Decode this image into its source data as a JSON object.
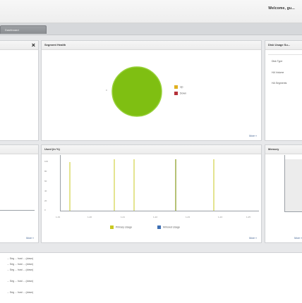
{
  "header": {
    "welcome_text": "Welcome, gu..."
  },
  "tabs": [
    {
      "label": "Dashboard"
    }
  ],
  "panels": {
    "left_top": {
      "close_glyph": "×"
    },
    "segment_health": {
      "title": "Segment Health",
      "footer": "More »",
      "legend": [
        {
          "label": "Up",
          "color": "#e0b020"
        },
        {
          "label": "Down",
          "color": "#b5323a"
        }
      ],
      "pie_color": "#7fbf12",
      "pie_label": "0"
    },
    "disk_usage": {
      "title": "Disk Usage Su...",
      "items": [
        "Disk Type",
        "HA Volume",
        "HA Segments"
      ]
    },
    "left_mid": {
      "footer": "More »"
    },
    "mid_chart": {
      "title": "Used (in %)",
      "footer": "More »",
      "y_ticks": [
        "100",
        "80",
        "60",
        "40",
        "20",
        "0"
      ],
      "x_ticks": [
        "1-19",
        "1-20",
        "1-21",
        "1-22",
        "1-23",
        "1-24",
        "1-25"
      ],
      "legend": [
        {
          "label": "Primary Usage",
          "color": "#c8c821"
        },
        {
          "label": "Mirrored Usage",
          "color": "#3d6fb3"
        }
      ]
    },
    "memory": {
      "title": "Memory",
      "footer": "More »",
      "y_ticks": [
        "",
        "",
        "",
        "",
        "",
        ""
      ]
    }
  },
  "events": [
    "... Seg ... host ... (down)",
    "... Seg ... host ... (down)",
    "... Seg ... host ... (down)",
    "... Seg ... host ... (down)",
    "... Seg ... host ... (down)"
  ]
}
